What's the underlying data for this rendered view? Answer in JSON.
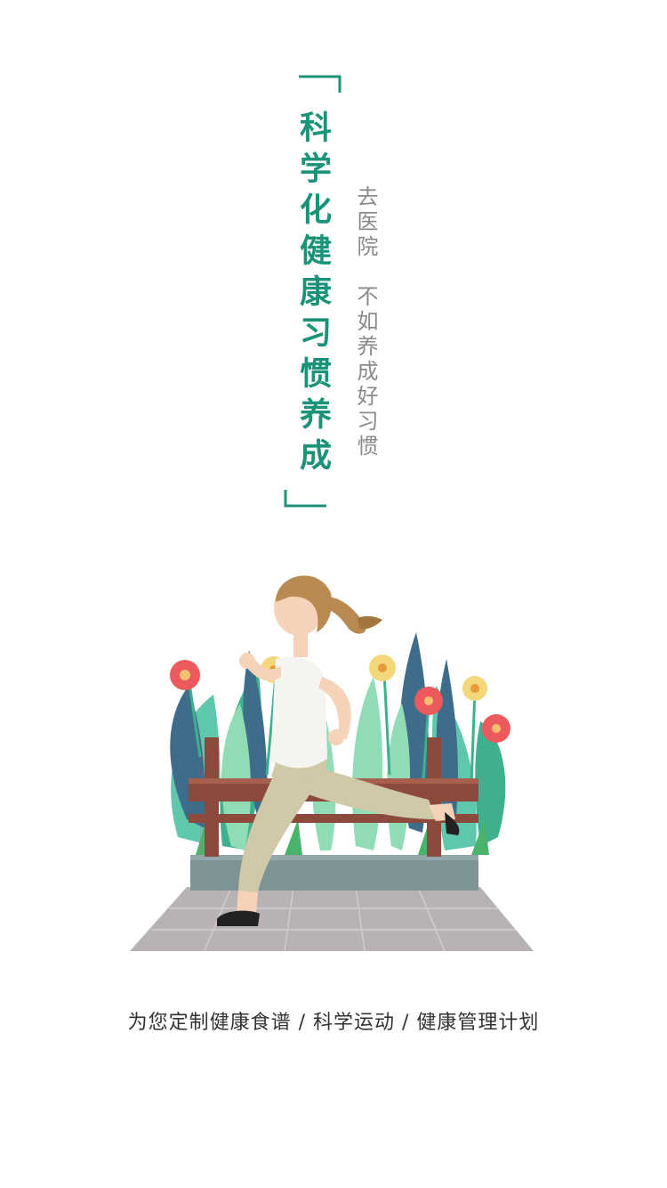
{
  "splash": {
    "headline": "科学化健康习惯养成",
    "subtitle_line1": "去医院",
    "subtitle_line2": "不如养成好习惯",
    "tagline": "为您定制健康食谱 / 科学运动 / 健康管理计划"
  },
  "colors": {
    "accent": "#1a9378",
    "subtitle": "#8a8a8a",
    "tagline": "#333333",
    "background": "#ffffff"
  },
  "icons": {
    "illustration": "woman-running-illustration"
  }
}
